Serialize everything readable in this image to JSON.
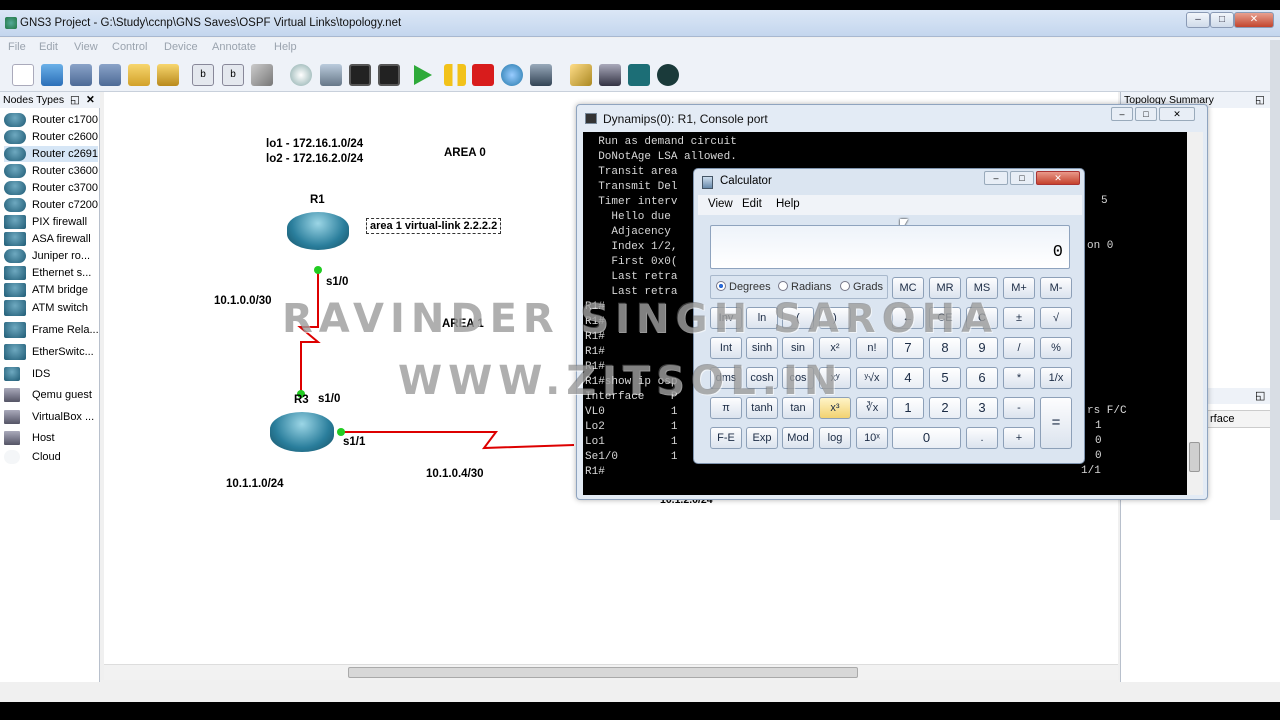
{
  "window": {
    "title": "GNS3 Project - G:\\Study\\ccnp\\GNS Saves\\OSPF Virtual Links\\topology.net"
  },
  "menu": [
    "File",
    "Edit",
    "View",
    "Control",
    "Device",
    "Annotate",
    "Help"
  ],
  "nodes_panel": {
    "title": "Nodes Types",
    "items": [
      "Router c1700",
      "Router c2600",
      "Router c2691",
      "Router c3600",
      "Router c3700",
      "Router c7200",
      "PIX firewall",
      "ASA firewall",
      "Juniper ro...",
      "Ethernet s...",
      "ATM bridge",
      "ATM switch",
      "Frame Rela...",
      "EtherSwitc...",
      "IDS",
      "Qemu guest",
      "VirtualBox ...",
      "Host",
      "Cloud"
    ],
    "selected": "Router c2691"
  },
  "topology_summary": {
    "title": "Topology Summary",
    "row": "rface"
  },
  "canvas": {
    "lo_lines": [
      "lo1 - 172.16.1.0/24",
      "lo2 - 172.16.2.0/24"
    ],
    "area0": "AREA 0",
    "area1": "AREA 1",
    "r1": "R1",
    "r3": "R3",
    "note": "area 1 virtual-link 2.2.2.2",
    "r1_if": "s1/0",
    "r3_if1": "s1/0",
    "r3_if2": "s1/1",
    "net1": "10.1.0.0/30",
    "net2": "10.1.1.0/24",
    "net3": "10.1.0.4/30",
    "net4": "10.1.2.0/24"
  },
  "console": {
    "title": "Dynamips(0): R1, Console port",
    "lines": [
      "  Run as demand circuit",
      "  DoNotAge LSA allowed.",
      "  Transit area",
      "  Transmit Del",
      "  Timer interv",
      "    Hello due",
      "    Adjacency",
      "    Index 1/2,",
      "    First 0x0(",
      "    Last retra",
      "    Last retra",
      "R1#",
      "R1#",
      "R1#",
      "R1#",
      "R1#",
      "R1#show ip osp",
      "Interface    P",
      "VL0          1",
      "Lo2          1",
      "Lo1          1",
      "Se1/0        1",
      "R1#"
    ],
    "right_fragments": [
      "5",
      "on 0",
      "rs F/C",
      "1",
      "0",
      "0",
      "1/1"
    ]
  },
  "calculator": {
    "title": "Calculator",
    "menu": [
      "View",
      "Edit",
      "Help"
    ],
    "display": "0",
    "modes": [
      "Degrees",
      "Radians",
      "Grads"
    ],
    "memory": [
      "MC",
      "MR",
      "MS",
      "M+",
      "M-"
    ],
    "rows": [
      [
        "Inv",
        "ln",
        "(",
        ")",
        "←",
        "CE",
        "C",
        "±",
        "√"
      ],
      [
        "Int",
        "sinh",
        "sin",
        "x²",
        "n!",
        "7",
        "8",
        "9",
        "/",
        "%"
      ],
      [
        "dms",
        "cosh",
        "cos",
        "xʸ",
        "ʸ√x",
        "4",
        "5",
        "6",
        "*",
        "1/x"
      ],
      [
        "π",
        "tanh",
        "tan",
        "x³",
        "∛x",
        "1",
        "2",
        "3",
        "-",
        "="
      ],
      [
        "F-E",
        "Exp",
        "Mod",
        "log",
        "10ˣ",
        "0",
        ".",
        "+"
      ]
    ]
  },
  "watermark": [
    "RAVINDER SINGH SAROHA",
    "WWW.ZITSOL.IN"
  ]
}
